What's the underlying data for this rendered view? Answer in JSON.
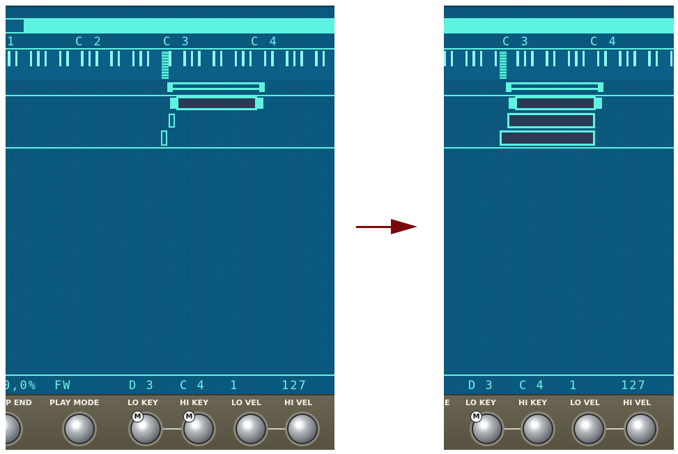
{
  "left_panel": {
    "octaves": [
      "1",
      "C 2",
      "C 3",
      "C 4"
    ],
    "params": [
      "0,0%",
      "FW",
      "D 3",
      "C 4",
      "1",
      "127"
    ],
    "knobs": [
      "P END",
      "PLAY MODE",
      "LO KEY",
      "HI KEY",
      "LO VEL",
      "HI VEL"
    ],
    "m_badge": "M"
  },
  "right_panel": {
    "octaves": [
      "C 3",
      "C 4"
    ],
    "params": [
      "D 3",
      "C 4",
      "1",
      "127"
    ],
    "knobs": [
      "E",
      "LO KEY",
      "HI KEY",
      "LO VEL",
      "HI VEL"
    ],
    "m_badge": "M"
  },
  "colors": {
    "panel_bg": "#0c5f86",
    "accent": "#5ef2e0",
    "zone_fill": "#2a3a55",
    "arrow": "#7a0a0a"
  },
  "icons": [
    "right-arrow-icon",
    "knob-icon",
    "midi-m-icon"
  ]
}
